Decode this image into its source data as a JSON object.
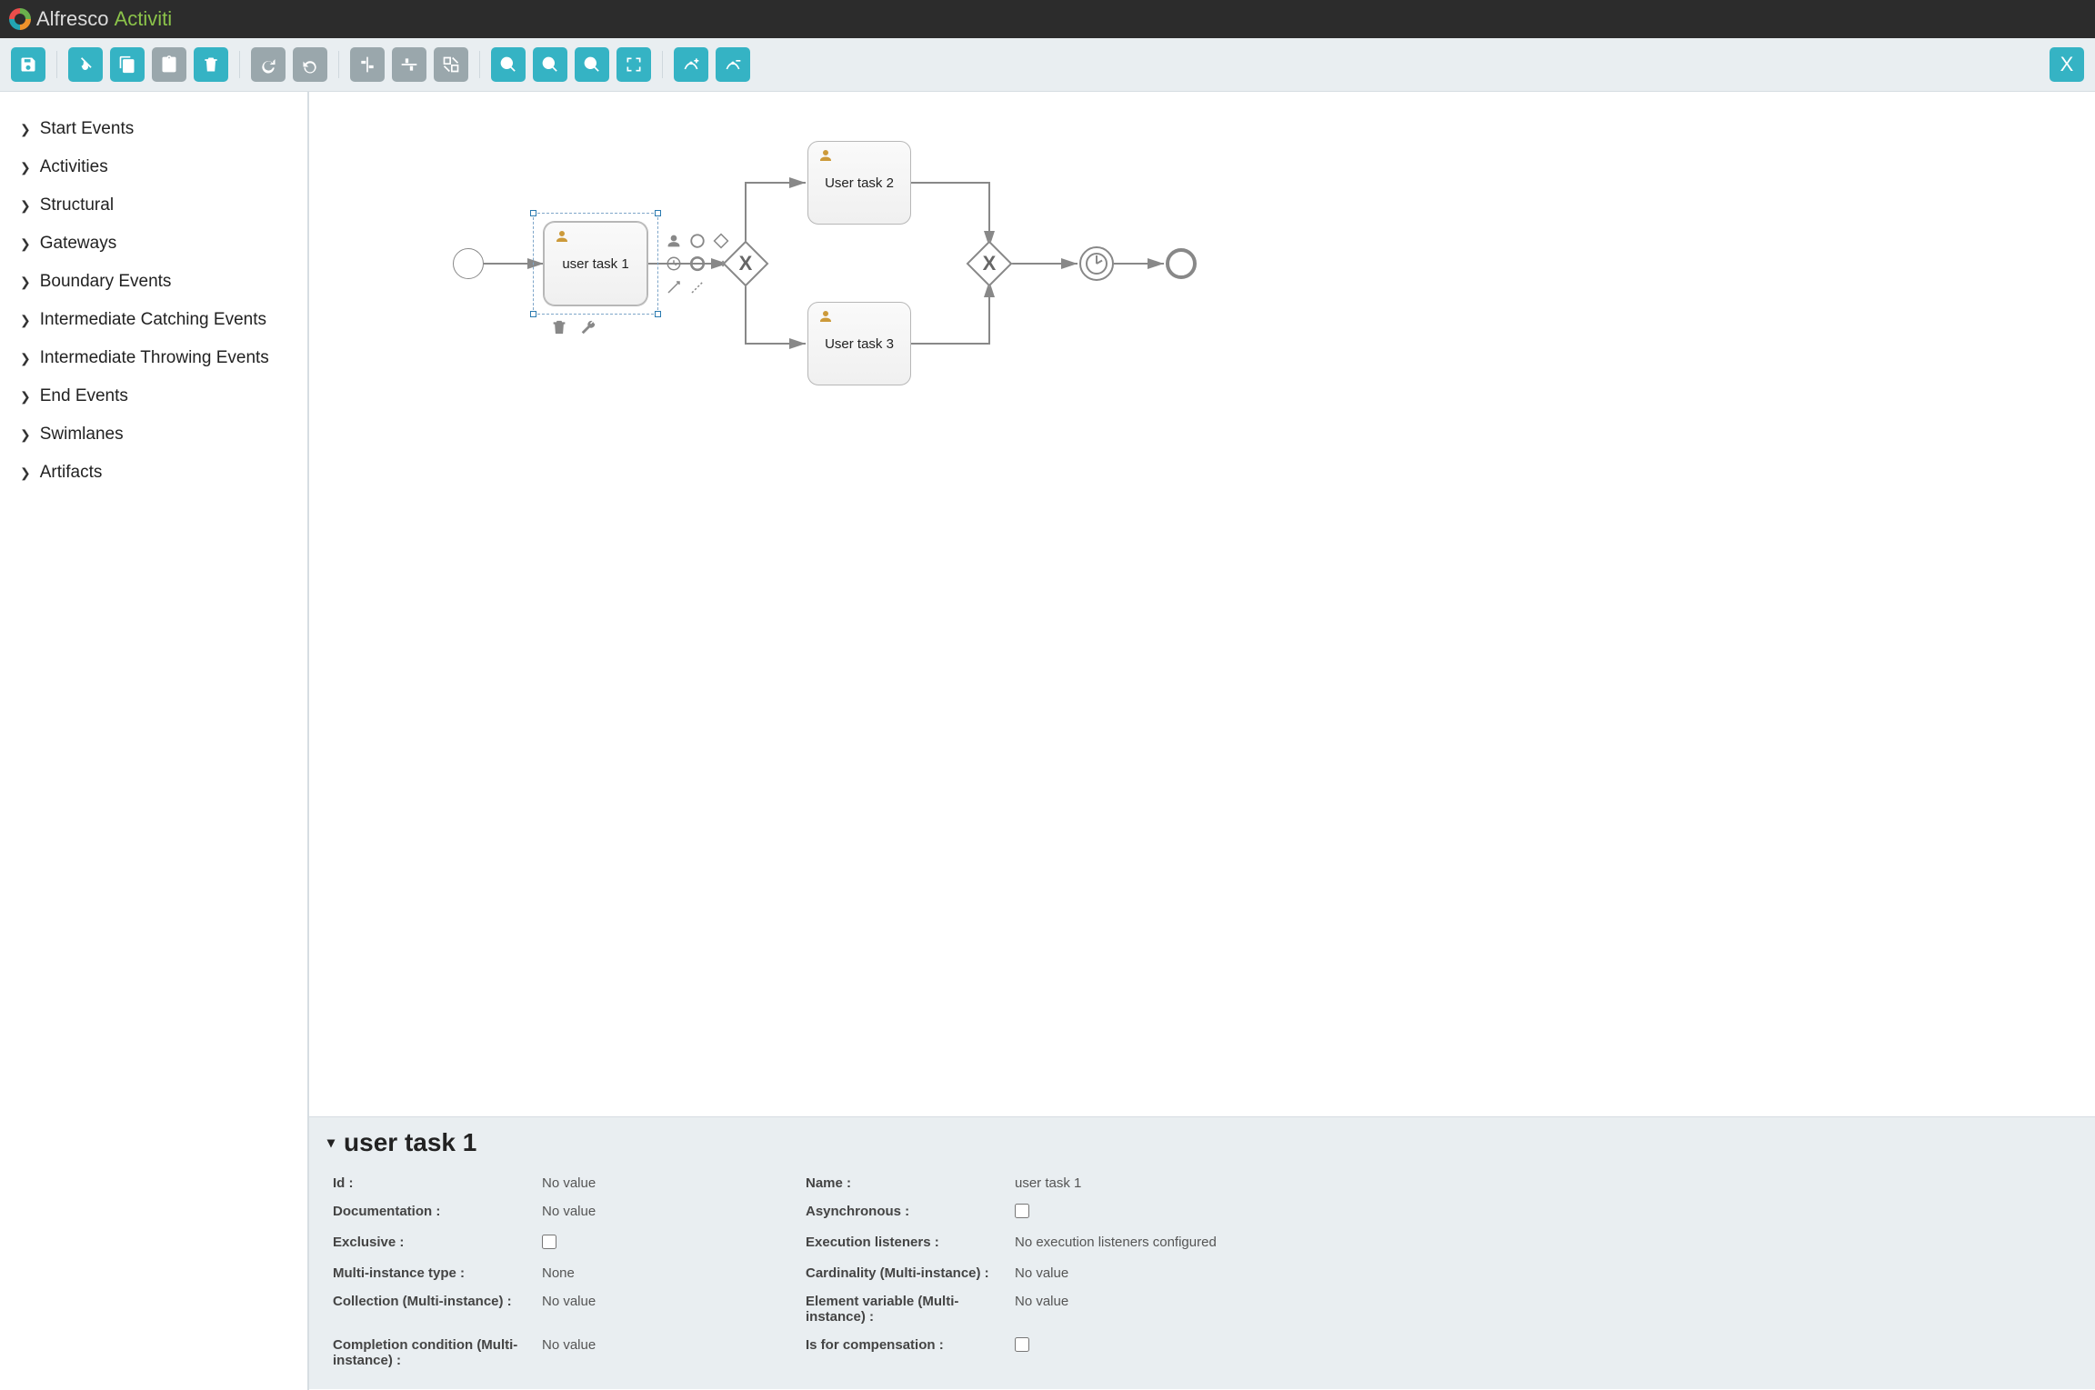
{
  "brand": {
    "name1": "Alfresco",
    "name2": "Activiti"
  },
  "palette": [
    "Start Events",
    "Activities",
    "Structural",
    "Gateways",
    "Boundary Events",
    "Intermediate Catching Events",
    "Intermediate Throwing Events",
    "End Events",
    "Swimlanes",
    "Artifacts"
  ],
  "diagram": {
    "tasks": [
      {
        "id": "t1",
        "label": "user task 1"
      },
      {
        "id": "t2",
        "label": "User task 2"
      },
      {
        "id": "t3",
        "label": "User task 3"
      }
    ]
  },
  "selected": {
    "title": "user task 1",
    "rows": [
      {
        "l1": "Id :",
        "v1": "No value",
        "l2": "Name :",
        "v2": "user task 1",
        "t2": "text"
      },
      {
        "l1": "Documentation :",
        "v1": "No value",
        "l2": "Asynchronous :",
        "v2": "",
        "t2": "check"
      },
      {
        "l1": "Exclusive :",
        "v1": "",
        "t1": "check",
        "l2": "Execution listeners :",
        "v2": "No execution listeners configured",
        "t2": "text"
      },
      {
        "l1": "Multi-instance type :",
        "v1": "None",
        "l2": "Cardinality (Multi-instance) :",
        "v2": "No value",
        "t2": "text"
      },
      {
        "l1": "Collection (Multi-instance) :",
        "v1": "No value",
        "l2": "Element variable (Multi-instance) :",
        "v2": "No value",
        "t2": "text"
      },
      {
        "l1": "Completion condition (Multi-instance) :",
        "v1": "No value",
        "l2": "Is for compensation :",
        "v2": "",
        "t2": "check"
      }
    ]
  },
  "toolbar": {
    "save": "save",
    "cut": "cut",
    "copy": "copy",
    "paste": "paste",
    "delete": "delete",
    "redo": "redo",
    "undo": "undo",
    "alignv": "align-v",
    "alignh": "align-h",
    "samesize": "same-size",
    "zoomin": "zoom-in",
    "zoomout": "zoom-out",
    "zoomreset": "zoom-actual",
    "zoomfit": "zoom-fit",
    "addbend": "add-bendpoint",
    "rembend": "remove-bendpoint",
    "close": "close"
  }
}
